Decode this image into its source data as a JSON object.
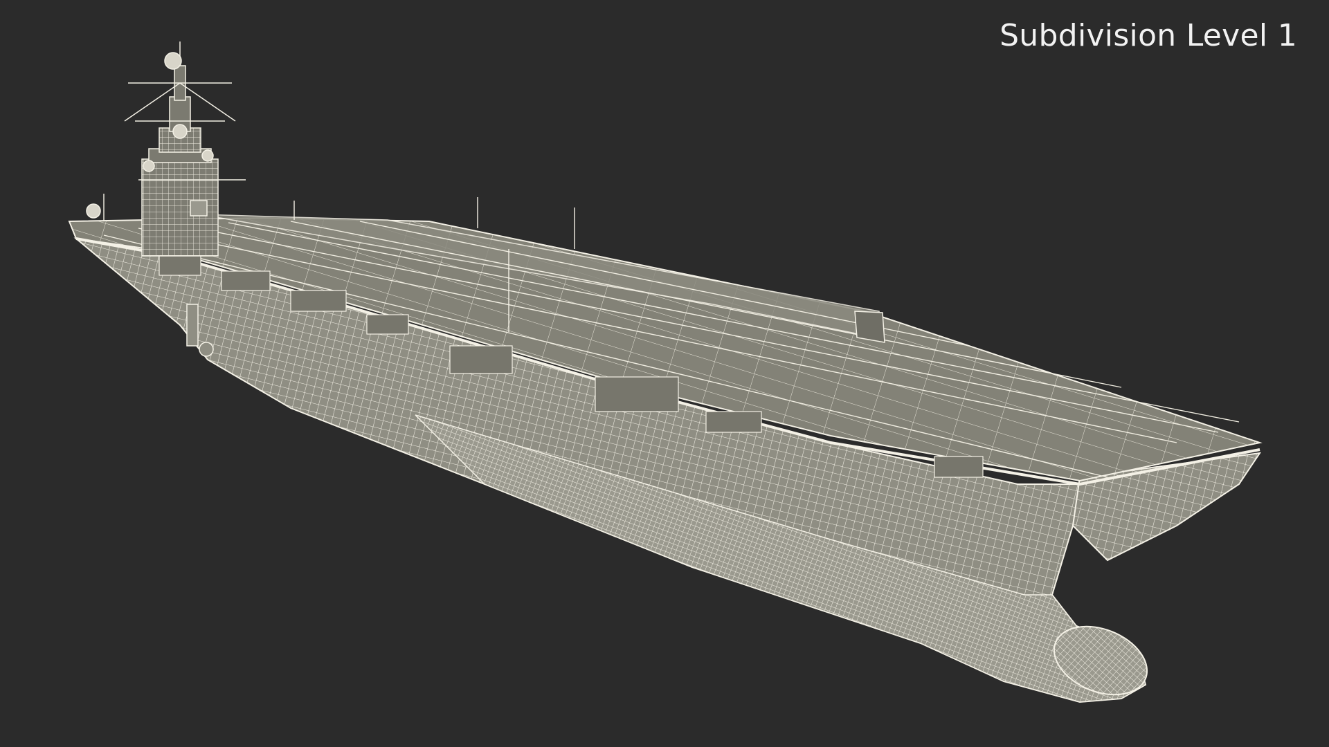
{
  "viewport": {
    "subdivision_label": "Subdivision Level 1",
    "background_color": "#2b2b2b",
    "wire_color": "#f4f1e6",
    "surface_color": "#8a897e",
    "surface_light_color": "#9b9a8f"
  },
  "model": {
    "icon": "aircraft-carrier-wireframe"
  }
}
